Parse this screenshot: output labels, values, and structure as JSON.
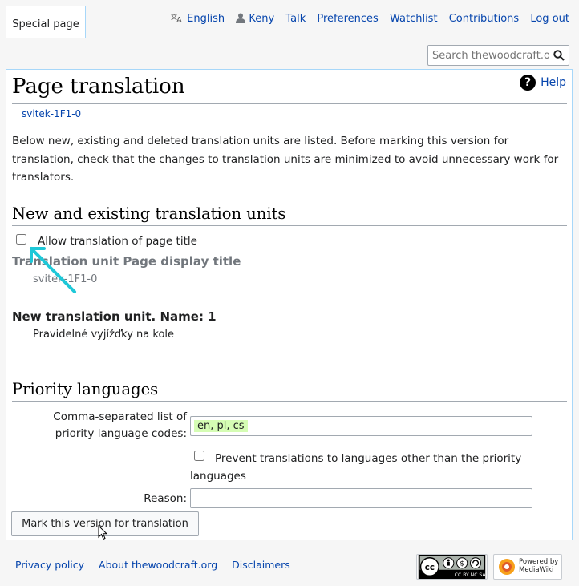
{
  "tabs": [
    {
      "label": "Special page"
    }
  ],
  "personal": {
    "language": "English",
    "user": "Keny",
    "talk": "Talk",
    "preferences": "Preferences",
    "watchlist": "Watchlist",
    "contributions": "Contributions",
    "logout": "Log out"
  },
  "search": {
    "placeholder": "Search thewoodcraft.org"
  },
  "page": {
    "title": "Page translation",
    "help": "Help",
    "subtitle": "svitek-1F1-0",
    "intro": "Below new, existing and deleted translation units are listed. Before marking this version for translation, check that the changes to translation units are minimized to avoid unnecessary work for translators."
  },
  "units_section": {
    "heading": "New and existing translation units",
    "allow_title_label": "Allow translation of page title",
    "unit1_title": "Translation unit Page display title",
    "unit1_text": "svitek-1F1-0",
    "unit2_title": "New translation unit. Name: 1",
    "unit2_text": "Pravidelné vyjížďky na kole"
  },
  "priority_section": {
    "heading": "Priority languages",
    "codes_label_line1": "Comma-separated list of",
    "codes_label_line2": "priority language codes:",
    "codes_value": "en, pl, cs",
    "prevent_label": "Prevent translations to languages other than the priority languages",
    "reason_label": "Reason:",
    "reason_value": ""
  },
  "submit_label": "Mark this version for translation",
  "footer": {
    "privacy": "Privacy policy",
    "about": "About thewoodcraft.org",
    "disclaimers": "Disclaimers",
    "cc_badge": "CC BY NC SA",
    "mw_line1": "Powered by",
    "mw_line2": "MediaWiki"
  },
  "colors": {
    "link": "#0645ad",
    "highlight": "#d5fdb4",
    "annotation_arrow": "#1ec8d8"
  }
}
